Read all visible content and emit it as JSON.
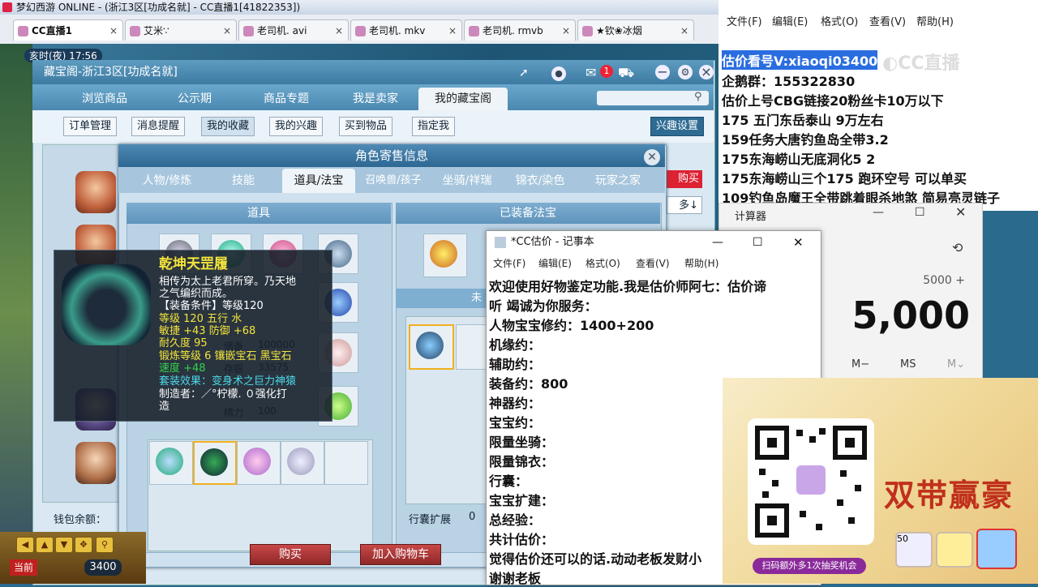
{
  "game_window": {
    "title": "梦幻西游 ONLINE - (浙江3区[功成名就] - CC直播1[41822353])"
  },
  "browser_tabs": [
    {
      "label": "CC直播1",
      "active": true
    },
    {
      "label": "艾米∵"
    },
    {
      "label": "老司机. avi"
    },
    {
      "label": "老司机. mkv"
    },
    {
      "label": "老司机. rmvb"
    },
    {
      "label": "★钦❀冰烟"
    }
  ],
  "game_hud": {
    "time_label": "亥时(夜) 17:56",
    "wallet_label": "钱包余额：",
    "speed_value": "3400",
    "current_label": "当前"
  },
  "cbg": {
    "window_title": "藏宝阁-浙江3区[功成名就]",
    "cart_badge": "1",
    "nav": [
      "浏览商品",
      "公示期",
      "商品专题",
      "我是卖家",
      "我的藏宝阁"
    ],
    "sub": [
      "订单管理",
      "消息提醒",
      "我的收藏",
      "我的兴趣",
      "买到物品",
      "指定我"
    ],
    "interest_settings": "兴趣设置",
    "buy_side": "购买",
    "more_side": "多↓"
  },
  "role_dialog": {
    "title": "角色寄售信息",
    "tabs": [
      "人物/修炼",
      "技能",
      "道具/法宝",
      "召唤兽/孩子",
      "坐骑/祥瑞",
      "锦衣/染色",
      "玩家之家"
    ],
    "items_header": "道具",
    "equip_header": "已装备法宝",
    "unequipped_label": "未",
    "stats": [
      {
        "label": "储备",
        "value": "100000"
      },
      {
        "label": "存银",
        "value": "33575"
      },
      {
        "label": "精力",
        "value": "100"
      }
    ],
    "bag_expand_label": "行囊扩展",
    "bag_expand_value": "0",
    "buy_button": "购买",
    "cart_button": "加入购物车"
  },
  "tooltip": {
    "name": "乾坤天罡履",
    "desc1": "相传为太上老君所穿。乃天地",
    "desc2": "之气编织而成。",
    "req": "【装备条件】等级120",
    "line1": "等级 120  五行 水",
    "line2": "敏捷 +43 防御 +68",
    "line3": "耐久度 95",
    "line4": "锻炼等级 6  镶嵌宝石 黑宝石",
    "line5": "速度 +48",
    "set_effect": "套装效果：变身术之巨力神猿",
    "maker1": "制造者：／°柠檬. ０强化打",
    "maker2": "造"
  },
  "notepad_top": {
    "menu": [
      "文件(F)",
      "编辑(E)",
      "格式(O)",
      "查看(V)",
      "帮助(H)"
    ],
    "lines": [
      "估价看号V:xiaoqi03400",
      "企鹅群：155322830",
      "估价上号CBG链接20粉丝卡10万以下",
      "175 五门东岳泰山  9万左右",
      "159任务大唐钓鱼岛全带3.2",
      "175东海崂山无底洞化5  2",
      "175东海崂山三个175 跑环空号 可以单买",
      "109钓鱼岛魔王全带跳着眼杀地煞 简易亮灵链子"
    ]
  },
  "calculator": {
    "title": "计算器",
    "expression": "5000 +",
    "display": "5,000",
    "mem_buttons": [
      "M−",
      "MS",
      "M⌄"
    ]
  },
  "notepad": {
    "title": "*CC估价 - 记事本",
    "menu": [
      "文件(F)",
      "编辑(E)",
      "格式(O)",
      "查看(V)",
      "帮助(H)"
    ],
    "lines": [
      "欢迎使用好物鉴定功能.我是估价师阿七：估价谛",
      "听 竭诚为你服务：",
      "人物宝宝修约：1400+200",
      "机缘约：",
      "辅助约：",
      "装备约：800",
      "神器约：",
      "宝宝约：",
      "限量坐骑：",
      "限量锦衣：",
      "行囊：",
      "宝宝扩建：",
      "总经验：",
      "共计估价：",
      "觉得估价还可以的话.动动老板发财小",
      "谢谢老板"
    ]
  },
  "promo": {
    "title": "双带赢豪",
    "scan_text": "扫码额外多1次抽奖机会",
    "thumb_label": "50"
  },
  "colors": {
    "accent": "#3d7aa3",
    "tip_yellow": "#f4e43c",
    "tip_green": "#34d24a",
    "tip_cyan": "#4cd8e8"
  }
}
